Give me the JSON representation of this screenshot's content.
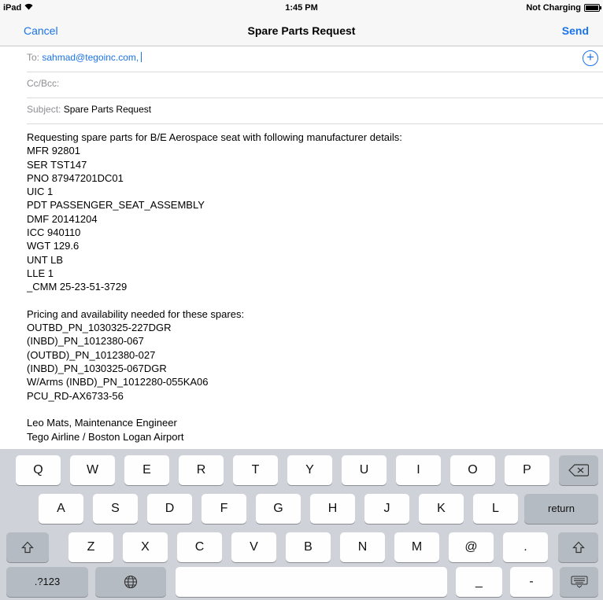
{
  "status_bar": {
    "device": "iPad",
    "time": "1:45 PM",
    "battery_status": "Not Charging"
  },
  "nav": {
    "cancel": "Cancel",
    "title": "Spare Parts Request",
    "send": "Send"
  },
  "compose": {
    "to_label": "To:",
    "to_value": "sahmad@tegoinc.com,",
    "cc_label": "Cc/Bcc:",
    "subject_label": "Subject:",
    "subject_value": "Spare Parts Request"
  },
  "body_lines": [
    "Requesting spare parts for B/E Aerospace seat with following manufacturer details:",
    "MFR 92801",
    "SER TST147",
    "PNO 87947201DC01",
    "UIC 1",
    "PDT PASSENGER_SEAT_ASSEMBLY",
    "DMF 20141204",
    "ICC 940110",
    "WGT 129.6",
    "UNT LB",
    "LLE 1",
    "_CMM 25-23-51-3729",
    "",
    "Pricing and availability needed for these spares:",
    "OUTBD_PN_1030325-227DGR",
    "(INBD)_PN_1012380-067",
    "(OUTBD)_PN_1012380-027",
    "(INBD)_PN_1030325-067DGR",
    "W/Arms (INBD)_PN_1012280-055KA06",
    "PCU_RD-AX6733-56",
    "",
    "Leo Mats, Maintenance Engineer",
    "Tego Airline / Boston Logan Airport"
  ],
  "keyboard": {
    "row1": [
      "Q",
      "W",
      "E",
      "R",
      "T",
      "Y",
      "U",
      "I",
      "O",
      "P"
    ],
    "row2": [
      "A",
      "S",
      "D",
      "F",
      "G",
      "H",
      "J",
      "K",
      "L"
    ],
    "return_label": "return",
    "row3": [
      "Z",
      "X",
      "C",
      "V",
      "B",
      "N",
      "M",
      "@",
      "."
    ],
    "numbers_label": ".?123",
    "underscore": "_",
    "dash": "-",
    "icons": {
      "delete": "delete-icon",
      "shift": "shift-icon",
      "globe": "globe-icon",
      "dismiss": "keyboard-dismiss-icon",
      "add": "add-contact-icon",
      "wifi": "wifi-icon",
      "battery": "battery-icon"
    }
  }
}
